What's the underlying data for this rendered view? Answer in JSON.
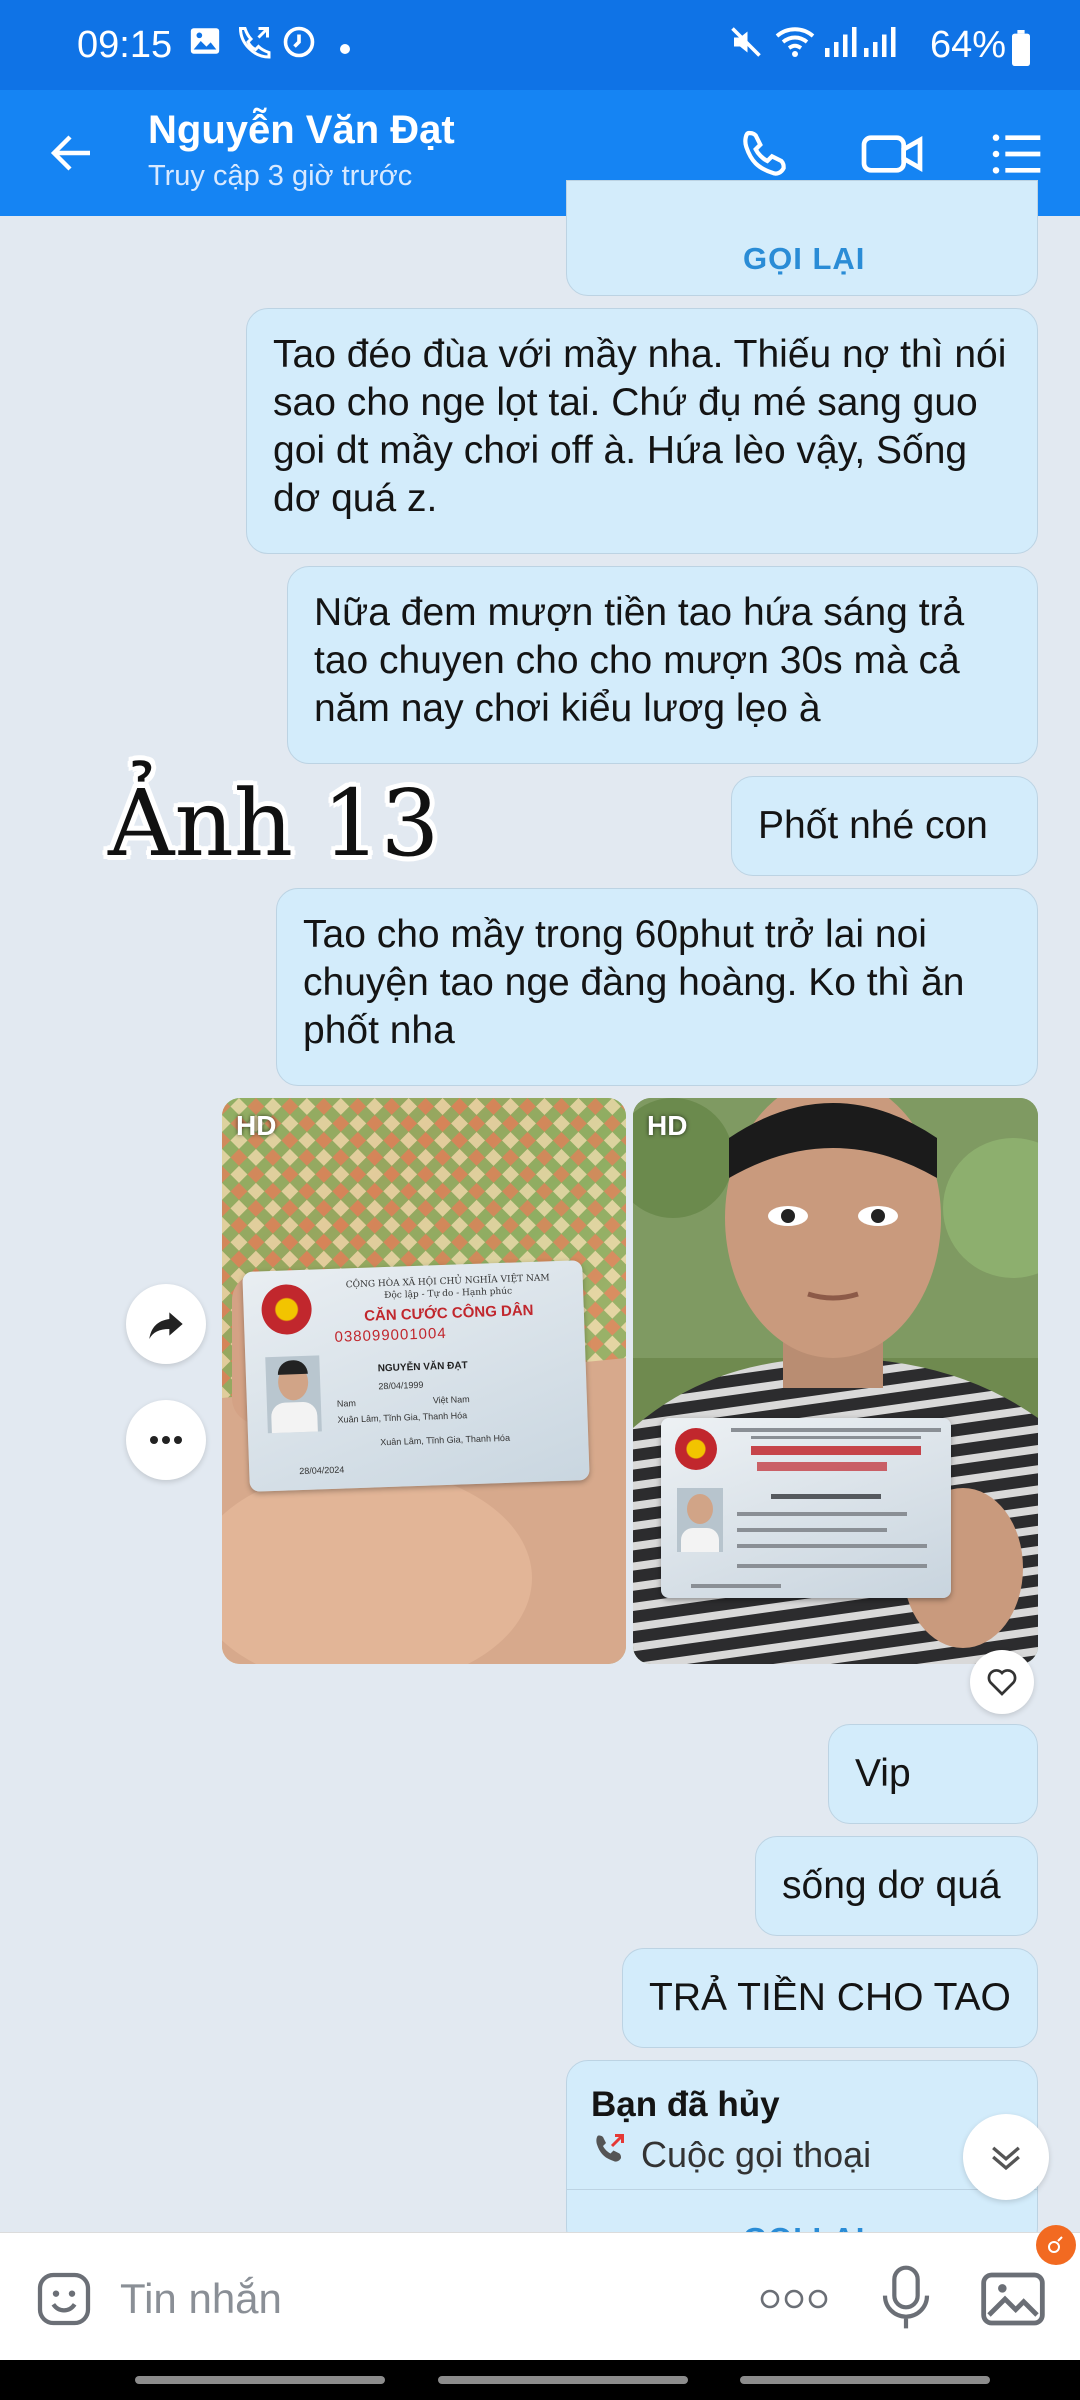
{
  "status_bar": {
    "time": "09:15",
    "battery": "64%",
    "icons": [
      "gallery-icon",
      "call-forward-icon",
      "clock-icon",
      "dot-icon",
      "mute-icon",
      "wifi-icon",
      "signal-icon",
      "battery-icon"
    ]
  },
  "header": {
    "name": "Nguyễn Văn Đạt",
    "status": "Truy cập 3 giờ trước",
    "icons": [
      "back-arrow-icon",
      "phone-icon",
      "video-icon",
      "menu-icon"
    ]
  },
  "messages": {
    "callback_top": "GỌI LẠI",
    "m1": "Tao đéo đùa với mầy nha. Thiếu nợ thì nói sao cho nge lọt tai. Chứ đụ mé sang guo goi dt mầy chơi off à. Hứa lèo vậy, Sống dơ quá z.",
    "m2": "Nữa đem mượn tiền tao hứa sáng trả tao chuyen cho cho mượn 30s mà cả năm nay chơi kiểu lươg lẹo à",
    "m3": "Phốt nhé con",
    "m4": "Tao cho mầy trong 60phut trở lai noi chuyện tao nge đàng hoàng. Ko thì ăn phốt nha",
    "photo_badge_1": "HD",
    "photo_badge_2": "HD",
    "m5": "Vip",
    "m6": "sống dơ quá",
    "m7": "TRẢ TIỀN CHO TAO",
    "call_title": "Bạn đã hủy",
    "call_sub": "Cuộc gọi thoại",
    "callback_bottom": "GỌI LẠI"
  },
  "id_card": {
    "header1": "CỘNG HÒA XÃ HỘI CHỦ NGHĨA VIỆT NAM",
    "header2": "Độc lập - Tự do - Hạnh phúc",
    "title": "CĂN CƯỚC CÔNG DÂN",
    "number": "038099001004",
    "name": "NGUYỄN VĂN ĐẠT",
    "dob": "28/04/1999",
    "sex": "Nam",
    "nationality": "Việt Nam",
    "origin": "Xuân Lâm, Tĩnh Gia, Thanh Hóa",
    "residence": "Xuân Lâm, Tĩnh Gia, Thanh Hóa",
    "expiry": "28/04/2024"
  },
  "watermark": "Ảnh 13",
  "input": {
    "placeholder": "Tin nhắn"
  },
  "colors": {
    "header": "#1584f3",
    "statusbar": "#0f73e6",
    "bubble": "#d3ecfb",
    "background": "#e2e9f1",
    "accent": "#2a8cd6"
  }
}
